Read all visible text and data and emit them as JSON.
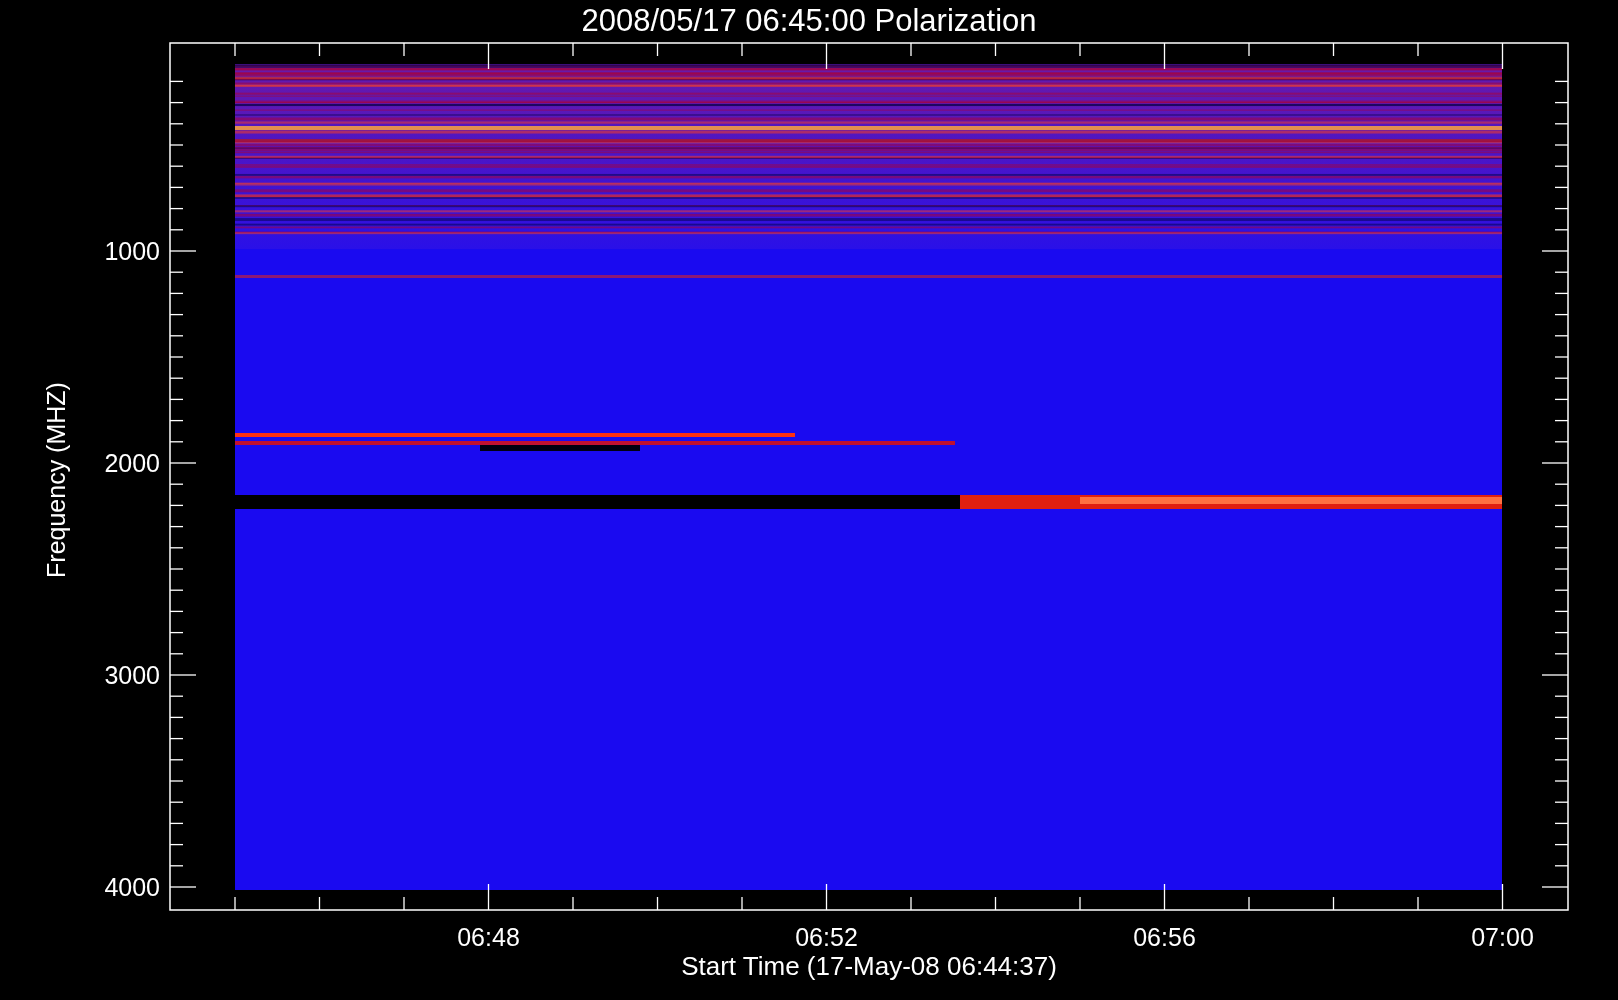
{
  "title": "2008/05/17 06:45:00 Polarization",
  "y_axis": {
    "label": "Frequency (MHZ)",
    "ticks": [
      "1000",
      "2000",
      "3000",
      "4000"
    ]
  },
  "x_axis": {
    "label": "Start Time (17-May-08 06:44:37)",
    "ticks": [
      "06:48",
      "06:52",
      "06:56",
      "07:00"
    ]
  }
}
